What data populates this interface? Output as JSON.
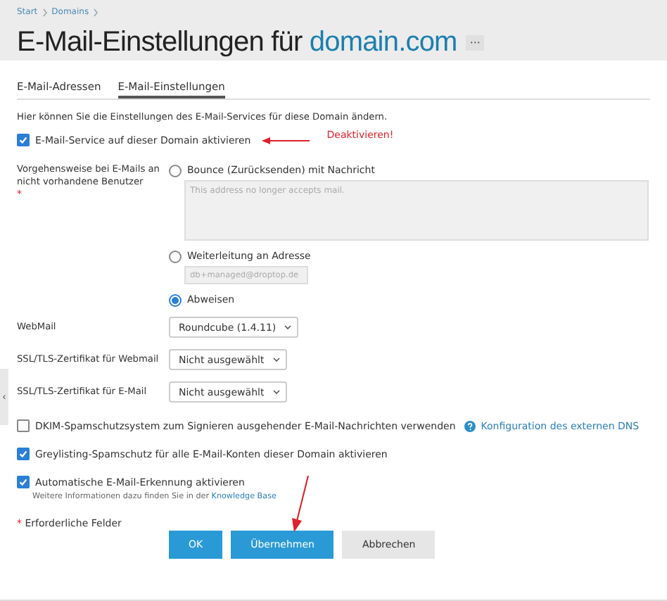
{
  "breadcrumb": [
    {
      "label": "Start"
    },
    {
      "label": "Domains"
    }
  ],
  "title": {
    "text": "E-Mail-Einstellungen für",
    "domain": "domain.com",
    "more": "···"
  },
  "tabs": [
    {
      "label": "E-Mail-Adressen",
      "selected": false
    },
    {
      "label": "E-Mail-Einstellungen",
      "selected": true
    }
  ],
  "intro": "Hier können Sie die Einstellungen des E-Mail-Services für diese Domain ändern.",
  "service": {
    "label": "E-Mail-Service auf dieser Domain aktivieren",
    "checked": true,
    "annotation": "Deaktivieren!"
  },
  "fallback": {
    "label": "Vorgehensweise bei E-Mails an nicht vorhandene Benutzer",
    "required": "*",
    "options": [
      {
        "kind": "textarea",
        "label": "Bounce (Zurücksenden) mit Nachricht",
        "selected": false,
        "placeholder": "This address no longer accepts mail."
      },
      {
        "kind": "input",
        "label": "Weiterleitung an Adresse",
        "selected": false,
        "placeholder": "db+managed@droptop.de"
      },
      {
        "kind": "plain",
        "label": "Abweisen",
        "selected": true
      }
    ]
  },
  "selects": [
    {
      "label": "WebMail",
      "value": "Roundcube (1.4.11)"
    },
    {
      "label": "SSL/TLS-Zertifikat für Webmail",
      "value": "Nicht ausgewählt"
    },
    {
      "label": "SSL/TLS-Zertifikat für E-Mail",
      "value": "Nicht ausgewählt"
    }
  ],
  "checkboxes": [
    {
      "label": "DKIM-Spamschutzsystem zum Signieren ausgehender E-Mail-Nachrichten verwenden",
      "checked": false,
      "link": "Konfiguration des externen DNS"
    },
    {
      "label": "Greylisting-Spamschutz für alle E-Mail-Konten dieser Domain aktivieren",
      "checked": true
    },
    {
      "label": "Automatische E-Mail-Erkennung aktivieren",
      "checked": true,
      "hint": "Weitere Informationen dazu finden Sie in der",
      "hint_link": "Knowledge Base"
    }
  ],
  "footer": {
    "required_mark": "*",
    "required_text": "Erforderliche Felder"
  },
  "buttons": [
    {
      "label": "OK",
      "kind": "primary"
    },
    {
      "label": "Übernehmen",
      "kind": "primary",
      "annotated": true
    },
    {
      "label": "Abbrechen",
      "kind": "secondary"
    }
  ],
  "side_handle": "‹"
}
